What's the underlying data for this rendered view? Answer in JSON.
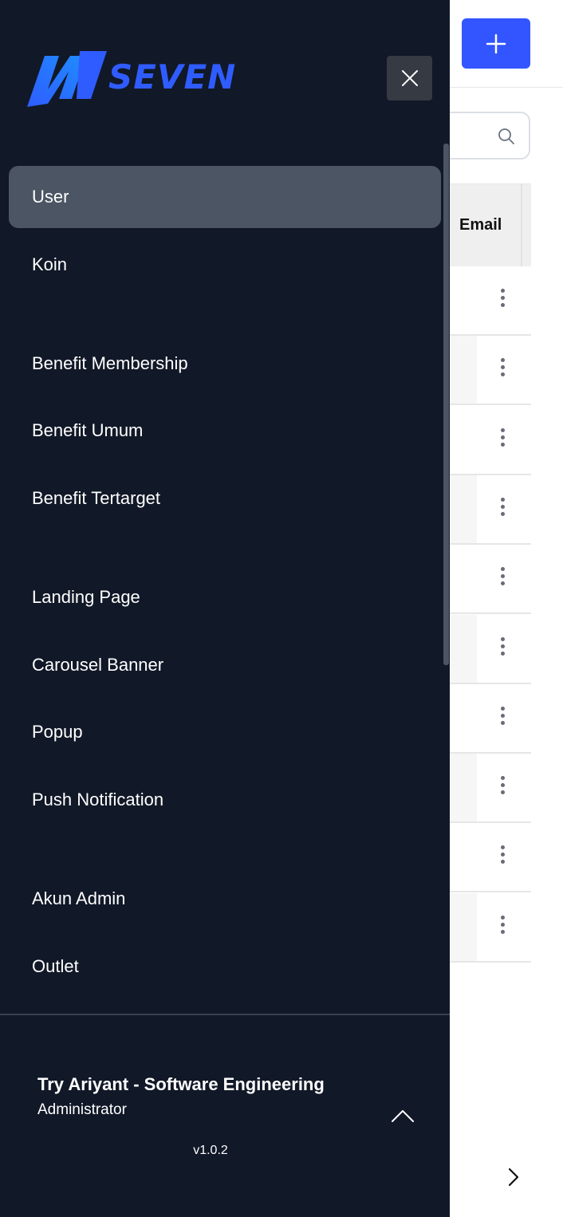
{
  "background_page": {
    "add_button_icon": "plus-icon",
    "search": {
      "icon": "search-icon"
    },
    "table": {
      "header_email": "Email",
      "row_action_icon": "kebab-menu-icon",
      "row_count": 10
    },
    "pagination_icon": "chevron-right-icon"
  },
  "sidebar": {
    "logo_text": "SEVEN",
    "close_icon": "close-icon",
    "items": [
      {
        "label": "User",
        "active": true
      },
      {
        "label": "Koin",
        "active": false
      },
      {
        "label": "Benefit Membership",
        "active": false
      },
      {
        "label": "Benefit Umum",
        "active": false
      },
      {
        "label": "Benefit Tertarget",
        "active": false
      },
      {
        "label": "Landing Page",
        "active": false
      },
      {
        "label": "Carousel Banner",
        "active": false
      },
      {
        "label": "Popup",
        "active": false
      },
      {
        "label": "Push Notification",
        "active": false
      },
      {
        "label": "Akun Admin",
        "active": false
      },
      {
        "label": "Outlet",
        "active": false
      }
    ],
    "user": {
      "name": "Try Ariyant - Software Engineering",
      "role": "Administrator",
      "expand_icon": "chevron-up-icon"
    },
    "version": "v1.0.2"
  },
  "colors": {
    "sidebar_bg": "#111827",
    "active_item_bg": "#4b5563",
    "brand_blue": "#2f5cff",
    "add_button": "#3355ff"
  }
}
